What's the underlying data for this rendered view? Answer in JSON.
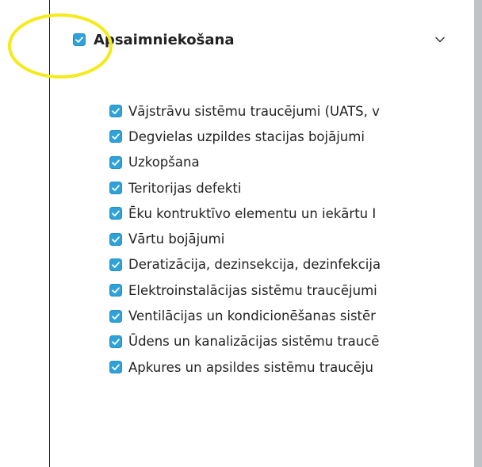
{
  "colors": {
    "checkbox_fill": "#2fa2d8",
    "text": "#222222",
    "highlight": "#f5ea1a",
    "scrollbar": "#bfc3c8"
  },
  "group": {
    "title": "Apsaimniekošana",
    "checked": true,
    "icon": "chevron-down-icon"
  },
  "items": [
    {
      "label": "Vājstrāvu sistēmu traucējumi (UATS, v",
      "checked": true
    },
    {
      "label": "Degvielas uzpildes stacijas bojājumi",
      "checked": true
    },
    {
      "label": "Uzkopšana",
      "checked": true
    },
    {
      "label": "Teritorijas defekti",
      "checked": true
    },
    {
      "label": "Ēku kontruktīvo elementu un iekārtu I",
      "checked": true
    },
    {
      "label": "Vārtu bojājumi",
      "checked": true
    },
    {
      "label": "Deratizācija, dezinsekcija, dezinfekcija",
      "checked": true
    },
    {
      "label": "Elektroinstalācijas sistēmu traucējumi",
      "checked": true
    },
    {
      "label": "Ventilācijas un kondicionēšanas sistēr",
      "checked": true
    },
    {
      "label": "Ūdens un kanalizācijas sistēmu traucē",
      "checked": true
    },
    {
      "label": "Apkures un apsildes sistēmu traucēju",
      "checked": true
    }
  ]
}
